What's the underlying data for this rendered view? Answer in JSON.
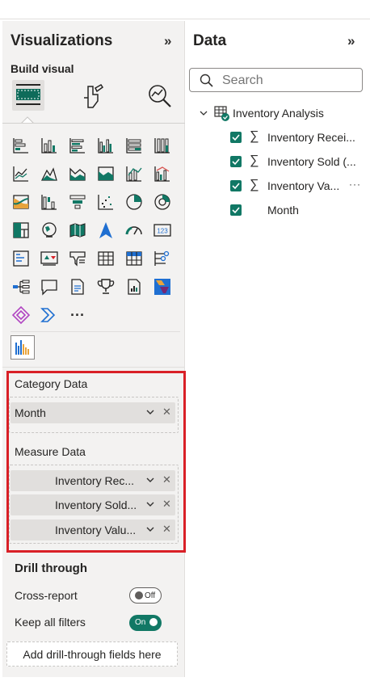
{
  "visualizations": {
    "title": "Visualizations",
    "build_visual_label": "Build visual",
    "tabs": [
      {
        "name": "build-visual-tab",
        "icon": "chart-fields-icon",
        "selected": true
      },
      {
        "name": "format-visual-tab",
        "icon": "paintbrush-icon",
        "selected": false
      },
      {
        "name": "analytics-tab",
        "icon": "magnify-chart-icon",
        "selected": false
      }
    ],
    "visual_types": [
      [
        "stacked-bar-chart-icon",
        "stacked-column-chart-icon",
        "clustered-bar-chart-icon",
        "clustered-column-chart-icon",
        "100pct-stacked-bar-chart-icon",
        "100pct-stacked-column-chart-icon"
      ],
      [
        "line-chart-icon",
        "area-chart-icon",
        "stacked-area-chart-icon",
        "100pct-stacked-area-chart-icon",
        "line-and-stacked-column-chart-icon",
        "line-and-clustered-column-chart-icon"
      ],
      [
        "ribbon-chart-icon",
        "waterfall-chart-icon",
        "funnel-icon",
        "scatter-chart-icon",
        "pie-chart-icon",
        "donut-chart-icon"
      ],
      [
        "treemap-icon",
        "map-icon",
        "filled-map-icon",
        "azure-map-icon",
        "gauge-icon",
        "card-icon"
      ],
      [
        "multi-row-card-icon",
        "kpi-icon",
        "slicer-icon",
        "table-icon",
        "matrix-icon",
        "key-influencers-icon"
      ],
      [
        "decomposition-tree-icon",
        "qa-icon",
        "smart-narrative-icon",
        "goals-trophy-icon",
        "paginated-report-icon",
        "power-apps-icon"
      ],
      [
        "power-automate-icon",
        "power-automate-flow-icon",
        "more-visuals-icon"
      ]
    ],
    "custom_visual_icon": "custom-column-visual-icon",
    "wells": {
      "category": {
        "title": "Category Data",
        "fields": [
          {
            "label": "Month"
          }
        ]
      },
      "measure": {
        "title": "Measure Data",
        "fields": [
          {
            "label": "Inventory Rec..."
          },
          {
            "label": "Inventory Sold..."
          },
          {
            "label": "Inventory Valu..."
          }
        ]
      }
    },
    "drill_through": {
      "title": "Drill through",
      "cross_report": {
        "label": "Cross-report",
        "state": "Off"
      },
      "keep_all_filters": {
        "label": "Keep all filters",
        "state": "On"
      },
      "add_fields": "Add drill-through fields here"
    }
  },
  "data_pane": {
    "title": "Data",
    "search": {
      "placeholder": "Search",
      "value": ""
    },
    "table": {
      "name": "Inventory Analysis",
      "expanded": true
    },
    "fields": [
      {
        "label": "Inventory Recei...",
        "checked": true,
        "measure": true,
        "more": false
      },
      {
        "label": "Inventory Sold (...",
        "checked": true,
        "measure": true,
        "more": false
      },
      {
        "label": "Inventory Va...",
        "checked": true,
        "measure": true,
        "more": true
      },
      {
        "label": "Month",
        "checked": true,
        "measure": false,
        "more": false
      }
    ]
  },
  "colors": {
    "accent": "#117865",
    "highlight": "#d92027",
    "pane_bg": "#f3f2f1",
    "pill_bg": "#e1dfdd"
  }
}
